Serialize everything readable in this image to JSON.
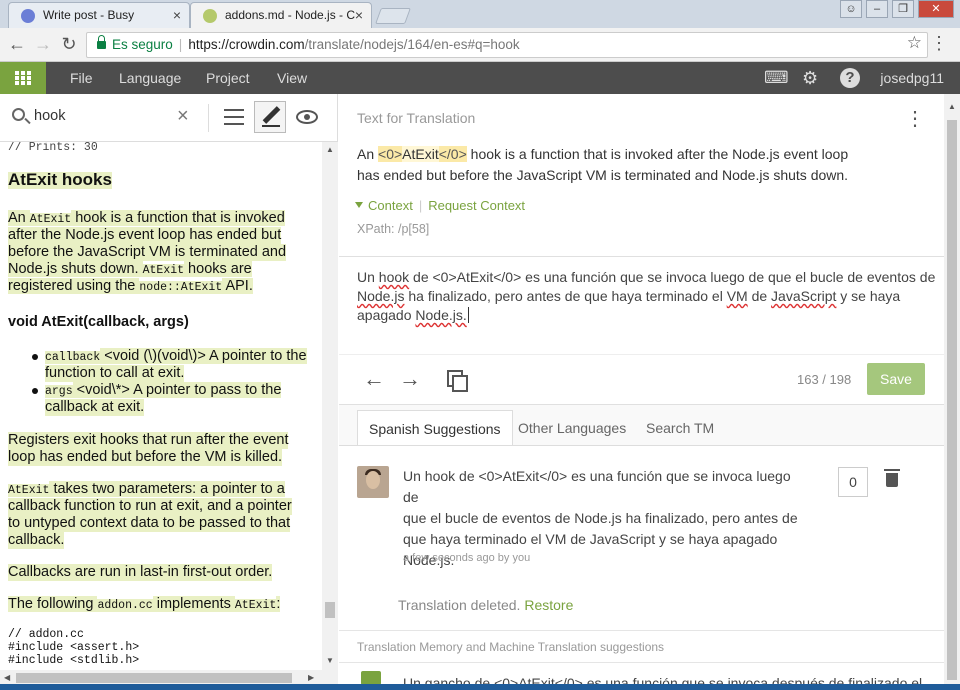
{
  "browser": {
    "tabs": [
      {
        "title": "Write post - Busy",
        "icon": "busy-icon"
      },
      {
        "title": "addons.md - Node.js - C",
        "icon": "crowdin-icon"
      }
    ],
    "secure_label": "Es seguro",
    "url_host": "https://crowdin.com",
    "url_path": "/translate/nodejs/164/en-es#q=hook"
  },
  "appbar": {
    "menu": [
      "File",
      "Language",
      "Project",
      "View"
    ],
    "user": "josedpg11"
  },
  "search": {
    "value": "hook"
  },
  "document": {
    "prints_comment": "// Prints: 30",
    "heading": "AtExit hooks",
    "para1_lines": [
      [
        "An ",
        "AtExit",
        " hook is a function that is invoked"
      ],
      [
        "after the Node.js event loop has ended but"
      ],
      [
        "before the JavaScript VM is terminated and"
      ],
      [
        "Node.js shuts down. ",
        "AtExit",
        " hooks are"
      ],
      [
        "registered using the ",
        "node::AtExit",
        " API."
      ]
    ],
    "subheading": "void AtExit(callback, args)",
    "bullet1": {
      "code": "callback",
      "text_line1": " <void (\\)(void\\)> A pointer to the",
      "text_line2": "function to call at exit."
    },
    "bullet2": {
      "code": "args",
      "text_line1": " <void\\*> A pointer to pass to the",
      "text_line2": "callback at exit."
    },
    "para2": [
      "Registers exit hooks that run after the event",
      "loop has ended but before the VM is killed."
    ],
    "para3": {
      "line1_code": "AtExit",
      "line1_text": " takes two parameters: a pointer to a",
      "line2": "callback function to run at exit, and a pointer",
      "line3": "to untyped context data to be passed to that",
      "line4": "callback."
    },
    "para4": "Callbacks are run in last-in first-out order.",
    "para5": {
      "pre": "The following ",
      "code1": "addon.cc",
      "mid": " implements ",
      "code2": "AtExit",
      "post": ":"
    },
    "code_lines": [
      "// addon.cc",
      "#include <assert.h>",
      "#include <stdlib.h>"
    ]
  },
  "editor": {
    "section_label": "Text for Translation",
    "source": {
      "pre": "An ",
      "tag_open": "<0>",
      "tag_word": "AtExit",
      "tag_close": "</0>",
      "line1_rest": " hook is a function that is invoked after the Node.js event loop",
      "line2": "has ended but before the JavaScript VM is terminated and Node.js shuts down."
    },
    "context_label": "Context",
    "request_context_label": "Request Context",
    "xpath": "XPath: /p[58]",
    "translation": {
      "l1a": "Un ",
      "l1b": "hook",
      "l1c": " de <0>",
      "l1d": "AtExit",
      "l1e": "</0> es una función que se invoca luego de que el bucle de eventos de",
      "l2a": "Node.js",
      "l2b": " ha finalizado, pero antes de que haya terminado el ",
      "l2c": "VM",
      "l2d": " de ",
      "l2e": "JavaScript",
      "l2f": " y se haya",
      "l3a": "apagado ",
      "l3b": "Node.js."
    },
    "counter": "163 / 198",
    "save_label": "Save"
  },
  "suggestions": {
    "tabs": [
      "Spanish Suggestions",
      "Other Languages",
      "Search TM"
    ],
    "item": {
      "lines": [
        "Un hook de <0>AtExit</0> es una función que se invoca luego de",
        "que el bucle de eventos de Node.js ha finalizado, pero antes de",
        "que haya terminado el VM de JavaScript y se haya apagado",
        "Node.js."
      ],
      "meta": "a few seconds ago by you",
      "votes": "0"
    },
    "deleted_text": "Translation deleted.",
    "restore_label": "Restore",
    "tm_heading": "Translation Memory and Machine Translation suggestions",
    "mt_text": "Un gancho de <0>AtExit</0> es una función que se invoca después de finalizado el"
  },
  "colors": {
    "accent": "#7aa33f",
    "appbar": "#4d4d4d",
    "highlight": "#e9f0c4",
    "save": "#a5c77d"
  }
}
